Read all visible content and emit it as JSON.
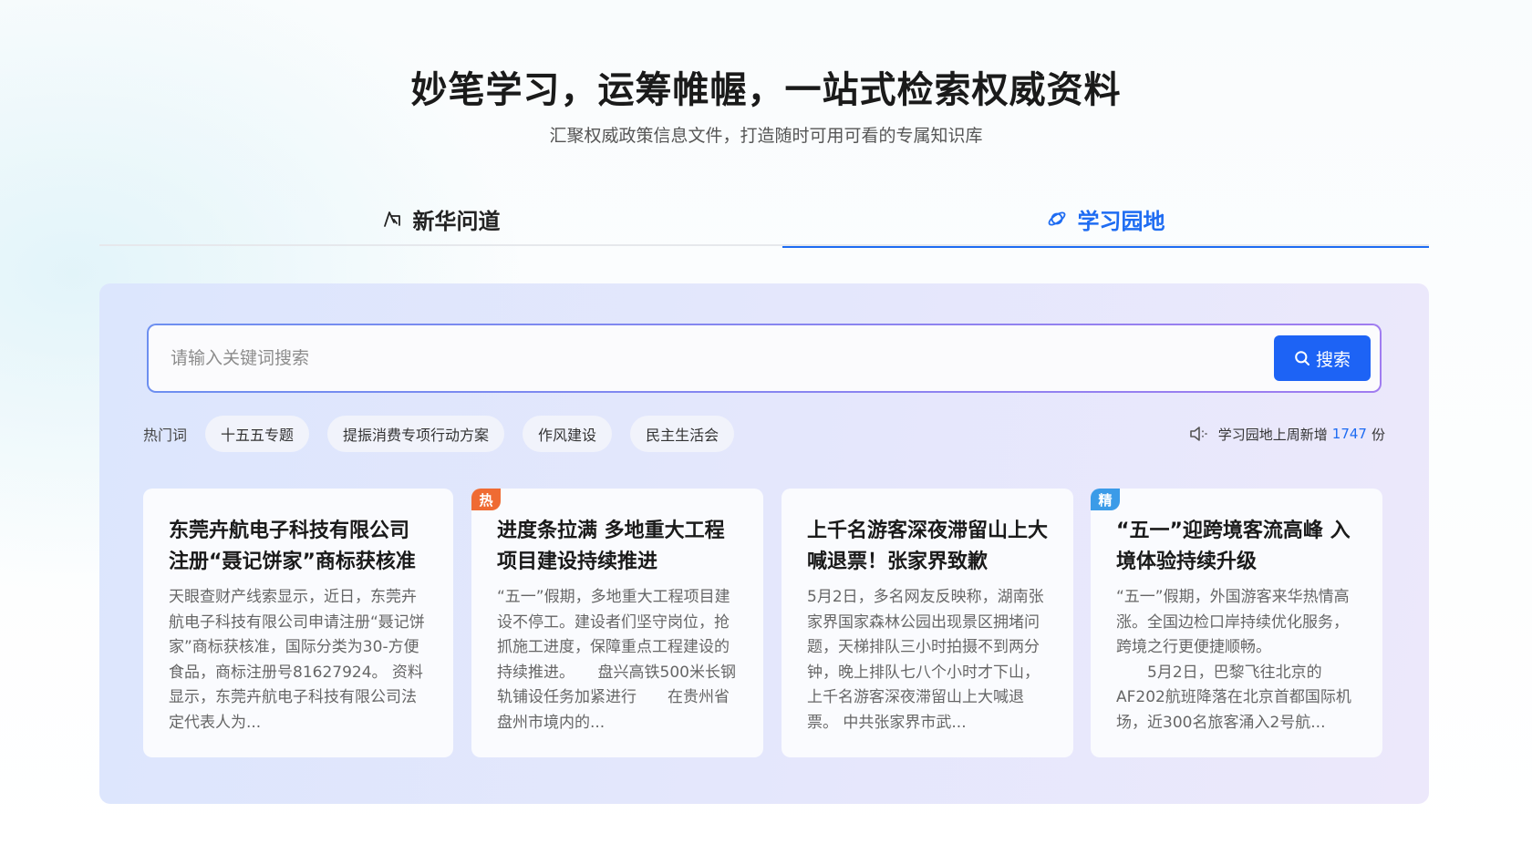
{
  "hero": {
    "title": "妙笔学习，运筹帷幄，一站式检索权威资料",
    "subtitle": "汇聚权威政策信息文件，打造随时可用可看的专属知识库"
  },
  "tabs": [
    {
      "label": "新华问道",
      "icon": "chat-icon",
      "active": false
    },
    {
      "label": "学习园地",
      "icon": "planet-icon",
      "active": true
    }
  ],
  "search": {
    "placeholder": "请输入关键词搜索",
    "value": "",
    "button_label": "搜索",
    "button_icon": "search-icon"
  },
  "hot": {
    "label": "热门词",
    "chips": [
      "十五五专题",
      "提振消费专项行动方案",
      "作风建设",
      "民主生活会"
    ]
  },
  "stat": {
    "icon": "speaker-icon",
    "prefix": "学习园地上周新增",
    "count": "1747",
    "suffix": "份"
  },
  "cards": [
    {
      "tag": null,
      "title": "东莞卉航电子科技有限公司注册“聂记饼家”商标获核准",
      "body": "天眼查财产线索显示，近日，东莞卉航电子科技有限公司申请注册“聂记饼家”商标获核准，国际分类为30-方便食品，商标注册号81627924。 资料显示，东莞卉航电子科技有限公司法定代表人为..."
    },
    {
      "tag": "热",
      "tag_color": "#ef6b33",
      "title": "进度条拉满 多地重大工程项目建设持续推进",
      "body": "“五一”假期，多地重大工程项目建设不停工。建设者们坚守岗位，抢抓施工进度，保障重点工程建设的持续推进。　　盘兴高铁500米长钢轨铺设任务加紧进行　　在贵州省盘州市境内的..."
    },
    {
      "tag": null,
      "title": "上千名游客深夜滞留山上大喊退票！张家界致歉",
      "body": "5月2日，多名网友反映称，湖南张家界国家森林公园出现景区拥堵问题，天梯排队三小时拍摄不到两分钟，晚上排队七八个小时才下山，上千名游客深夜滞留山上大喊退票。 中共张家界市武..."
    },
    {
      "tag": "精",
      "tag_color": "#3b9be8",
      "title": "“五一”迎跨境客流高峰 入境体验持续升级",
      "body": "“五一”假期，外国游客来华热情高涨。全国边检口岸持续优化服务，跨境之行更便捷顺畅。\n　　5月2日，巴黎飞往北京的AF202航班降落在北京首都国际机场，近300名旅客涌入2号航..."
    }
  ],
  "colors": {
    "accent": "#1e6cf2",
    "button": "#1d63f5",
    "hot_tag": "#ef6b33",
    "featured_tag": "#3b9be8"
  }
}
